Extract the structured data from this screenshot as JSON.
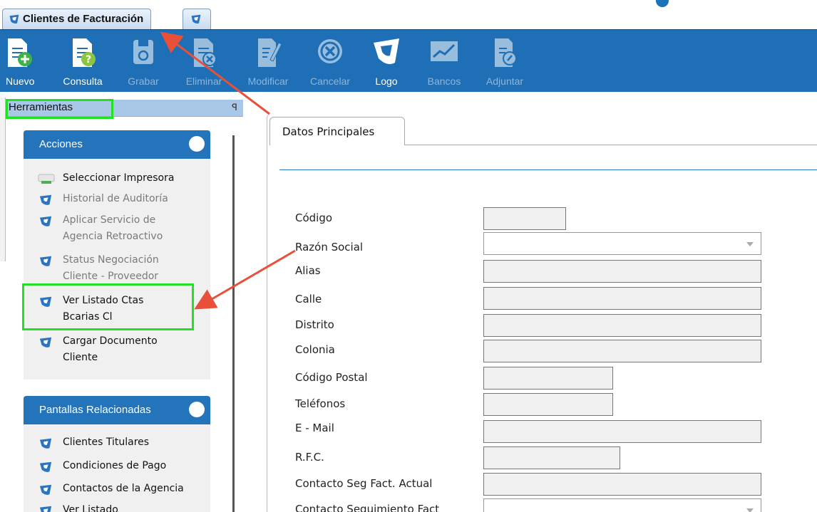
{
  "window": {
    "tab_title": "Clientes de Facturación"
  },
  "toolbar": {
    "buttons": [
      {
        "label": "Nuevo",
        "icon": "new-document-icon",
        "enabled": true
      },
      {
        "label": "Consulta",
        "icon": "query-document-icon",
        "enabled": true
      },
      {
        "label": "Grabar",
        "icon": "save-icon",
        "enabled": false
      },
      {
        "label": "Eliminar",
        "icon": "delete-document-icon",
        "enabled": false
      },
      {
        "label": "Modificar",
        "icon": "edit-document-icon",
        "enabled": false
      },
      {
        "label": "Cancelar",
        "icon": "cancel-icon",
        "enabled": false
      },
      {
        "label": "Logo",
        "icon": "logo-icon",
        "enabled": true
      },
      {
        "label": "Bancos",
        "icon": "chart-icon",
        "enabled": false
      },
      {
        "label": "Adjuntar",
        "icon": "attach-document-icon",
        "enabled": false
      }
    ]
  },
  "tools_panel": {
    "title": "Herramientas",
    "pin_glyph": "ꟼ",
    "groups": [
      {
        "title": "Acciones",
        "items": [
          {
            "label_lines": [
              "Seleccionar Impresora"
            ],
            "icon": "printer-icon",
            "enabled": true
          },
          {
            "label_lines": [
              "Historial de Auditoría"
            ],
            "icon": "logo-icon",
            "enabled": false
          },
          {
            "label_lines": [
              "Aplicar Servicio de",
              "Agencia Retroactivo"
            ],
            "icon": "logo-icon",
            "enabled": false
          },
          {
            "label_lines": [
              "Status Negociación",
              "Cliente - Proveedor"
            ],
            "icon": "logo-icon",
            "enabled": false
          },
          {
            "label_lines": [
              "Ver Listado Ctas",
              "Bcarias Cl"
            ],
            "icon": "logo-icon",
            "enabled": true
          },
          {
            "label_lines": [
              "Cargar Documento",
              "Cliente"
            ],
            "icon": "logo-icon",
            "enabled": true
          }
        ]
      },
      {
        "title": "Pantallas Relacionadas",
        "items": [
          {
            "label_lines": [
              "Clientes Titulares"
            ],
            "icon": "logo-icon",
            "enabled": true
          },
          {
            "label_lines": [
              "Condiciones de Pago"
            ],
            "icon": "logo-icon",
            "enabled": true
          },
          {
            "label_lines": [
              "Contactos de la Agencia"
            ],
            "icon": "logo-icon",
            "enabled": true
          },
          {
            "label_lines": [
              "Ver Listado"
            ],
            "icon": "logo-icon",
            "enabled": true
          }
        ]
      }
    ]
  },
  "form": {
    "tab_label": "Datos Principales",
    "fields": [
      {
        "label": "Código",
        "value": ""
      },
      {
        "label": "Razón Social",
        "value": ""
      },
      {
        "label": "Alias",
        "value": ""
      },
      {
        "label": "Calle",
        "value": ""
      },
      {
        "label": "Distrito",
        "value": ""
      },
      {
        "label": "Colonia",
        "value": ""
      },
      {
        "label": "Código Postal",
        "value": ""
      },
      {
        "label": "Teléfonos",
        "value": ""
      },
      {
        "label": "E - Mail",
        "value": ""
      },
      {
        "label": "R.F.C.",
        "value": ""
      },
      {
        "label": "Contacto Seg Fact. Actual",
        "value": ""
      },
      {
        "label": "Contacto Seguimiento Fact",
        "value": ""
      }
    ]
  },
  "colors": {
    "toolbar_bg": "#1e6fb5",
    "group_header_bg": "#2474bb",
    "highlight": "#22e022",
    "annotation_arrow": "#e8503a"
  }
}
